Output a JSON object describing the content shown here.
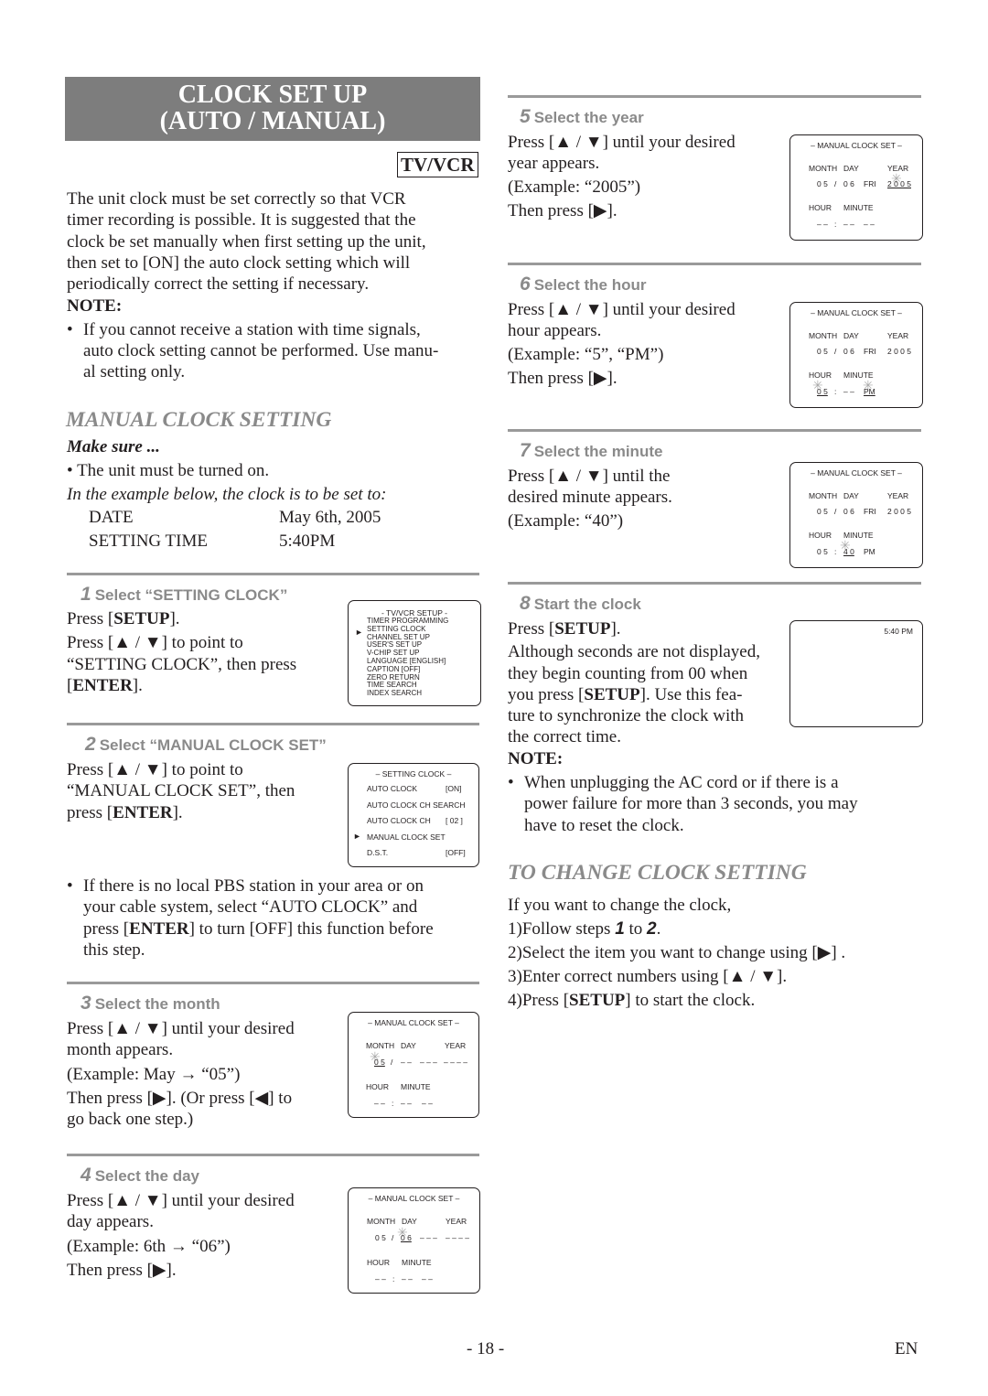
{
  "header": {
    "title_line1": "CLOCK SET UP",
    "title_line2": "(AUTO / MANUAL)",
    "badge": "TV/VCR"
  },
  "intro": {
    "lines": [
      "The unit clock must be set correctly so that VCR",
      "timer recording is possible. It is suggested that the",
      "clock be set manually when first setting up the unit,",
      "then set to [ON] the auto clock setting which will",
      "periodically correct the setting if necessary."
    ],
    "note_label": "NOTE:",
    "note_lines": [
      "If you cannot receive a station with time signals,",
      "auto clock setting cannot be performed. Use manu-",
      "al setting only."
    ]
  },
  "manual": {
    "heading": "MANUAL CLOCK SETTING",
    "make_sure": "Make sure ...",
    "bullet": "The unit must be turned on.",
    "example_intro": "In the example below, the clock is to be set to:",
    "date_label": "DATE",
    "date_value": "May 6th, 2005",
    "time_label": "SETTING TIME",
    "time_value": "5:40PM"
  },
  "steps": [
    {
      "num": "1",
      "title": "Select “SETTING CLOCK”",
      "lines": [
        "Press [SETUP].",
        "Press [▲ / ▼] to point to",
        "“SETTING CLOCK”, then press",
        "[ENTER]."
      ],
      "screen": {
        "title": "- TV/VCR SETUP -",
        "items": [
          "TIMER PROGRAMMING",
          "SETTING CLOCK",
          "CHANNEL SET UP",
          "USER'S SET UP",
          "V-CHIP SET UP",
          "LANGUAGE  [ENGLISH]",
          "CAPTION  [OFF]",
          "ZERO RETURN",
          "TIME SEARCH",
          "INDEX SEARCH"
        ],
        "selected_index": 1
      }
    },
    {
      "num": "2",
      "title": "Select “MANUAL CLOCK SET”",
      "lines": [
        "Press [▲ / ▼] to point to",
        "“MANUAL CLOCK SET”, then",
        "press [ENTER]."
      ],
      "screen": {
        "title": "– SETTING CLOCK –",
        "items": [
          {
            "label": "AUTO CLOCK",
            "value": "[ON]"
          },
          {
            "label": "AUTO CLOCK CH SEARCH",
            "value": ""
          },
          {
            "label": "AUTO CLOCK CH",
            "value": "[ 02 ]"
          },
          {
            "label": "MANUAL CLOCK SET",
            "value": ""
          },
          {
            "label": "D.S.T.",
            "value": "[OFF]"
          }
        ],
        "selected_index": 3
      },
      "after_bullet": [
        "If there is no local PBS station in your area or on",
        "your cable system, select “AUTO CLOCK” and",
        "press [ENTER] to turn [OFF] this function before",
        "this step."
      ]
    },
    {
      "num": "3",
      "title": "Select the month",
      "lines": [
        "Press [▲ / ▼] until your desired",
        "month appears.",
        "(Example: May → “05”)",
        "Then press [▶]. (Or press [◀] to",
        "go back one step.)"
      ],
      "screen": {
        "month": "0 5",
        "sep": "/",
        "day": "– –",
        "dow": "– – –",
        "year": "– – – –",
        "hour": "– –",
        "minute": "– –",
        "ampm": "– –",
        "blinking": "month"
      }
    },
    {
      "num": "4",
      "title": "Select the day",
      "lines": [
        "Press [▲ / ▼] until your desired",
        "day appears.",
        "(Example: 6th → “06”)",
        "Then press [▶]."
      ],
      "screen": {
        "month": "0 5",
        "sep": "/",
        "day": "0 6",
        "dow": "– – –",
        "year": "– – – –",
        "hour": "– –",
        "minute": "– –",
        "ampm": "– –",
        "blinking": "day"
      }
    },
    {
      "num": "5",
      "title": "Select the year",
      "lines": [
        "Press [▲ / ▼] until your desired",
        "year appears.",
        "(Example: “2005”)",
        "Then press [▶]."
      ],
      "screen": {
        "month": "0 5",
        "sep": "/",
        "day": "0 6",
        "dow": "FRI",
        "year": "2 0 0 5",
        "hour": "– –",
        "minute": "– –",
        "ampm": "– –",
        "blinking": "year"
      }
    },
    {
      "num": "6",
      "title": "Select the hour",
      "lines": [
        "Press [▲ / ▼] until your desired",
        "hour appears.",
        "(Example: “5”, “PM”)",
        "Then press [▶]."
      ],
      "screen": {
        "month": "0 5",
        "sep": "/",
        "day": "0 6",
        "dow": "FRI",
        "year": "2 0 0 5",
        "hour": "0 5",
        "minute": "– –",
        "ampm": "PM",
        "blinking": "hour"
      }
    },
    {
      "num": "7",
      "title": "Select the minute",
      "lines": [
        "Press [▲ / ▼] until the",
        "desired minute appears.",
        "(Example: “40”)"
      ],
      "screen": {
        "month": "0 5",
        "sep": "/",
        "day": "0 6",
        "dow": "FRI",
        "year": "2 0 0 5",
        "hour": "0 5",
        "minute": "4 0",
        "ampm": "PM",
        "blinking": "minute"
      }
    },
    {
      "num": "8",
      "title": "Start the clock",
      "lines": [
        "Press [SETUP].",
        "Although seconds are not displayed,",
        "they begin counting from 00 when",
        "you press [SETUP]. Use this fea-",
        "ture to synchronize the clock with",
        "the correct time."
      ],
      "screen": {
        "time": "5:40 PM"
      },
      "note_label": "NOTE:",
      "note_lines": [
        "When unplugging the AC cord or if there is a",
        "power failure for more than 3 seconds, you may",
        "have to reset the clock."
      ]
    }
  ],
  "screen_labels": {
    "title": "– MANUAL CLOCK SET –",
    "month": "MONTH",
    "day": "DAY",
    "year": "YEAR",
    "hour": "HOUR",
    "minute": "MINUTE"
  },
  "change": {
    "heading": "TO CHANGE CLOCK SETTING",
    "intro": "If you want to change the clock,",
    "items": [
      "1)Follow steps 1 to 2.",
      "2)Select the item you want to change using [▶] .",
      "3)Enter correct numbers using [▲ / ▼].",
      "4)Press [SETUP] to start the clock."
    ]
  },
  "footer": {
    "page": "- 18 -",
    "lang": "EN"
  }
}
